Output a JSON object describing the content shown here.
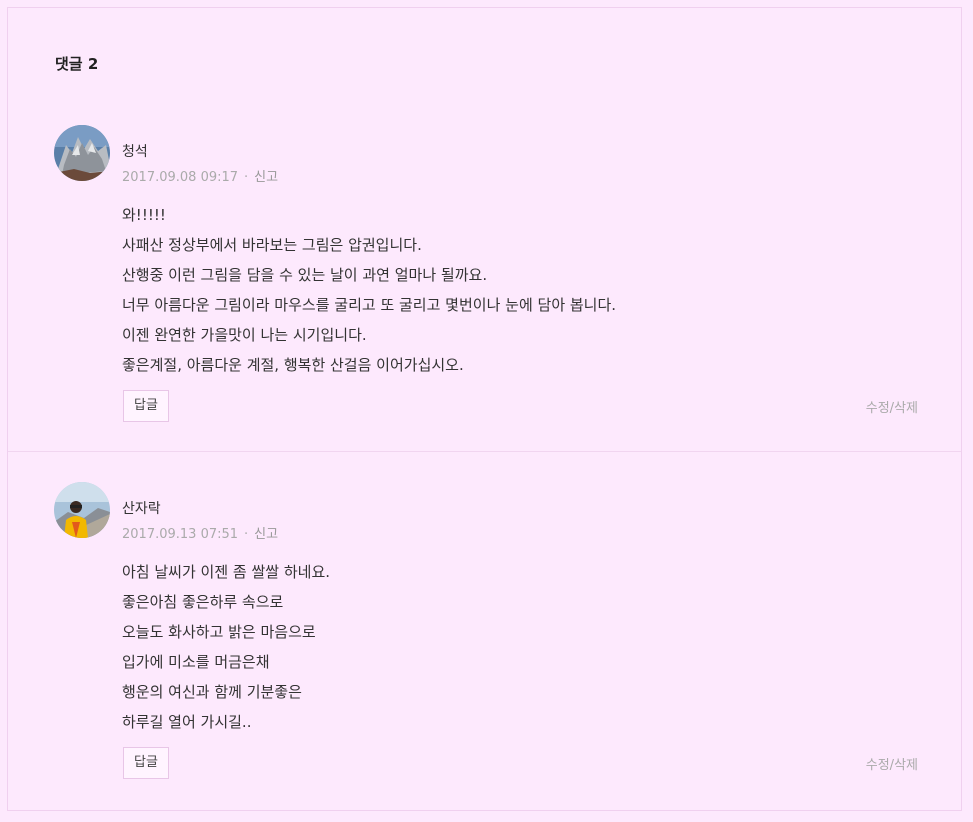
{
  "comments_header": {
    "label": "댓글 2"
  },
  "comments": [
    {
      "author": "청석",
      "date": "2017.09.08 09:17",
      "report_label": "신고",
      "lines": [
        "와!!!!!",
        "사패산 정상부에서 바라보는 그림은 압권입니다.",
        "산행중 이런 그림을 담을 수 있는 날이 과연 얼마나 될까요.",
        "너무 아름다운 그림이라 마우스를 굴리고 또 굴리고 몇번이나 눈에 담아 봅니다.",
        "이젠 완연한 가을맛이 나는 시기입니다.",
        "좋은계절, 아름다운 계절, 행복한 산걸음 이어가십시오."
      ],
      "reply_label": "답글",
      "edit_label": "수정/삭제"
    },
    {
      "author": "산자락",
      "date": "2017.09.13 07:51",
      "report_label": "신고",
      "lines": [
        "아침 날씨가 이젠 좀 쌀쌀 하네요.",
        "좋은아침 좋은하루 속으로",
        "오늘도 화사하고 밝은 마음으로",
        "입가에 미소를 머금은채",
        "행운의 여신과 함께 기분좋은",
        "하루길 열어 가시길.."
      ],
      "reply_label": "답글",
      "edit_label": "수정/삭제"
    }
  ]
}
